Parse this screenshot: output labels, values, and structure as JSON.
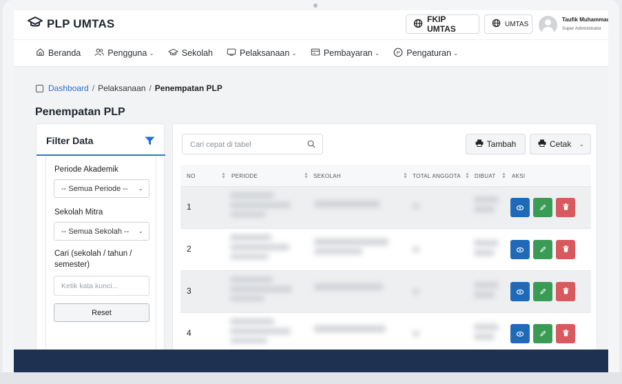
{
  "brand": {
    "name": "PLP UMTAS"
  },
  "header": {
    "fkip_label": "FKIP UMTAS",
    "umtas_label": "UMTAS",
    "user_name": "Taufik Muhammad",
    "user_role": "Super Administrator"
  },
  "nav": {
    "items": [
      {
        "label": "Beranda",
        "icon": "home-icon",
        "dropdown": false
      },
      {
        "label": "Pengguna",
        "icon": "users-icon",
        "dropdown": true
      },
      {
        "label": "Sekolah",
        "icon": "graduation-cap-icon",
        "dropdown": false
      },
      {
        "label": "Pelaksanaan",
        "icon": "monitor-icon",
        "dropdown": true
      },
      {
        "label": "Pembayaran",
        "icon": "receipt-icon",
        "dropdown": true
      },
      {
        "label": "Pengaturan",
        "icon": "settings-p-icon",
        "dropdown": true
      }
    ]
  },
  "breadcrumb": {
    "home": "Dashboard",
    "sep": "/",
    "middle": "Pelaksanaan",
    "current": "Penempatan PLP"
  },
  "page": {
    "title": "Penempatan PLP"
  },
  "filter": {
    "title": "Filter Data",
    "periode_label": "Periode Akademik",
    "periode_value": "-- Semua Periode --",
    "sekolah_label": "Sekolah Mitra",
    "sekolah_value": "-- Semua Sekolah --",
    "cari_label": "Cari (sekolah / tahun / semester)",
    "cari_placeholder": "Ketik kata kunci...",
    "reset_label": "Reset"
  },
  "table": {
    "search_placeholder": "Cari cepat di tabel",
    "tambah_label": "Tambah",
    "cetak_label": "Cetak",
    "columns": [
      "NO",
      "PERIODE",
      "SEKOLAH",
      "TOTAL ANGGOTA",
      "DIBUAT",
      "AKSI"
    ],
    "rows": [
      {
        "no": "1"
      },
      {
        "no": "2"
      },
      {
        "no": "3"
      },
      {
        "no": "4"
      }
    ]
  },
  "colors": {
    "primary": "#1f6ab8",
    "success": "#3a9b55",
    "danger": "#d85a5f",
    "footer": "#1e3150"
  }
}
